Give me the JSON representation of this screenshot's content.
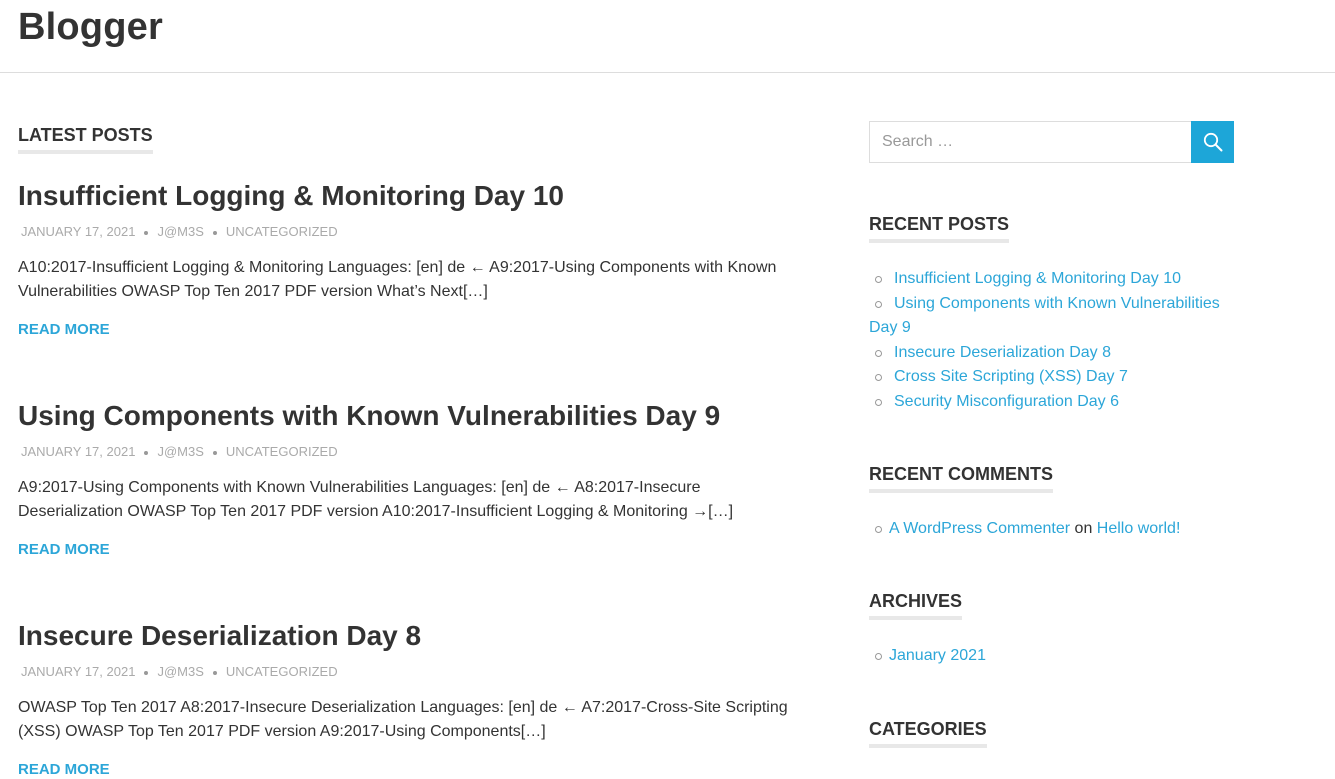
{
  "site": {
    "title": "Blogger"
  },
  "main": {
    "section_title": "LATEST POSTS",
    "read_more_label": "READ MORE",
    "posts": [
      {
        "title": "Insufficient Logging & Monitoring Day 10",
        "date": "JANUARY 17, 2021",
        "author": "J@M3S",
        "category": "UNCATEGORIZED",
        "excerpt": "A10:2017-Insufficient Logging & Monitoring Languages: [en] de ← A9:2017-Using Components with Known Vulnerabilities OWASP Top Ten 2017 PDF version What’s Next[…]"
      },
      {
        "title": "Using Components with Known Vulnerabilities Day 9",
        "date": "JANUARY 17, 2021",
        "author": "J@M3S",
        "category": "UNCATEGORIZED",
        "excerpt": "A9:2017-Using Components with Known Vulnerabilities Languages: [en] de ← A8:2017-Insecure Deserialization OWASP Top Ten 2017 PDF version A10:2017-Insufficient Logging & Monitoring →[…]"
      },
      {
        "title": "Insecure Deserialization Day 8",
        "date": "JANUARY 17, 2021",
        "author": "J@M3S",
        "category": "UNCATEGORIZED",
        "excerpt": "OWASP Top Ten 2017 A8:2017-Insecure Deserialization Languages: [en] de ← A7:2017-Cross-Site Scripting (XSS) OWASP Top Ten 2017 PDF version A9:2017-Using Components[…]"
      }
    ]
  },
  "sidebar": {
    "search": {
      "placeholder": "Search …"
    },
    "recent_posts": {
      "title": "RECENT POSTS",
      "items": [
        "Insufficient Logging & Monitoring Day 10",
        "Using Components with Known Vulnerabilities Day 9",
        "Insecure Deserialization Day 8",
        "Cross Site Scripting (XSS) Day 7",
        "Security Misconfiguration Day 6"
      ]
    },
    "recent_comments": {
      "title": "RECENT COMMENTS",
      "items": [
        {
          "author": "A WordPress Commenter",
          "connector": "on",
          "post": "Hello world!"
        }
      ]
    },
    "archives": {
      "title": "ARCHIVES",
      "items": [
        "January 2021"
      ]
    },
    "categories": {
      "title": "CATEGORIES"
    }
  },
  "colors": {
    "link": "#2ca6d8",
    "search_button": "#1da6d8",
    "text": "#333333",
    "meta": "#aaaaaa"
  },
  "icons": {
    "search_button": "search-icon"
  }
}
